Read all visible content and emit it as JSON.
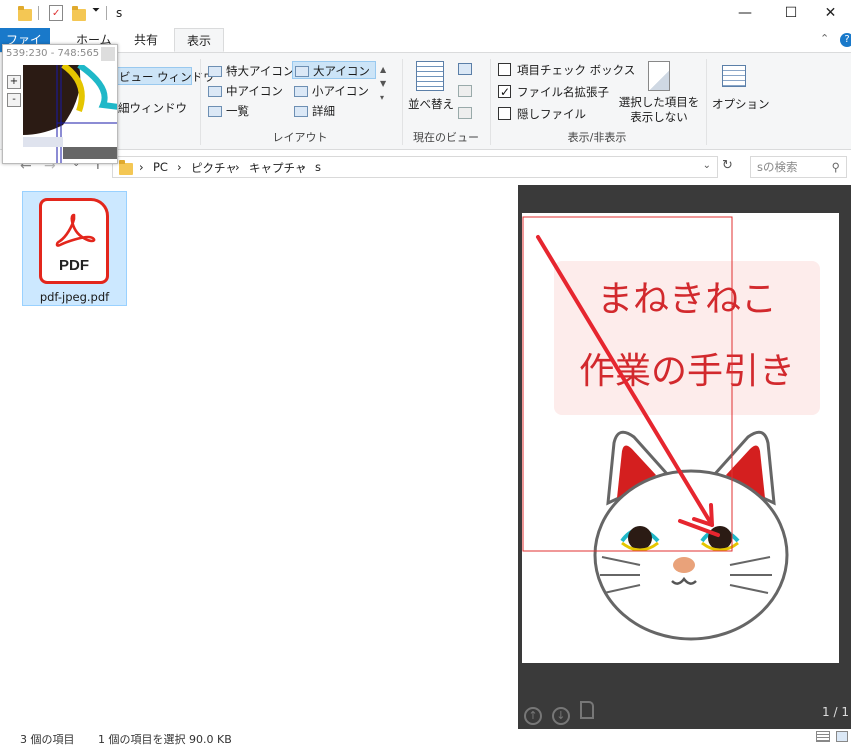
{
  "window": {
    "path_title": "s",
    "minimize": "—",
    "maximize": "☐",
    "close": "✕"
  },
  "tabs": [
    {
      "label": "ファイル"
    },
    {
      "label": "ホーム"
    },
    {
      "label": "共有"
    },
    {
      "label": "表示"
    }
  ],
  "ribbon": {
    "panes": {
      "preview_pane": "ビュー ウィンドウ",
      "details_pane": "細ウィンドウ"
    },
    "layout": {
      "items": [
        "特大アイコン",
        "大アイコン",
        "中アイコン",
        "小アイコン",
        "一覧",
        "詳細"
      ],
      "selected": "大アイコン",
      "group_label": "レイアウト"
    },
    "current_view": {
      "sort_label": "並べ替え",
      "group_label": "現在のビュー"
    },
    "show_hide": {
      "item_checkboxes": "項目チェック ボックス",
      "file_extensions": "ファイル名拡張子",
      "hidden_files": "隠しファイル",
      "hide_selected": "選択した項目を",
      "hide_selected_2": "表示しない",
      "group_label": "表示/非表示",
      "item_checkboxes_checked": false,
      "file_extensions_checked": true,
      "hidden_files_checked": false
    },
    "options_label": "オプション"
  },
  "address": {
    "crumbs": [
      "PC",
      "ピクチャ",
      "キャプチャ",
      "s"
    ],
    "search_placeholder": "sの検索"
  },
  "files": [
    {
      "name": "pdf-jpeg.pdf",
      "icon_text": "PDF"
    }
  ],
  "preview": {
    "title_line1": "まねきねこ",
    "title_line2": "作業の手引き",
    "page_indicator": "1 / 1"
  },
  "status": {
    "item_count": "3 個の項目",
    "selection": "1 個の項目を選択  90.0 KB"
  },
  "magnifier": {
    "coords": "539:230 - 748:565",
    "zoom_in": "+",
    "zoom_out": "-"
  },
  "colors": {
    "accent": "#1979ca",
    "pdf_red": "#e3261c",
    "title_pink": "#d2292d",
    "selection": "#cce8ff"
  }
}
